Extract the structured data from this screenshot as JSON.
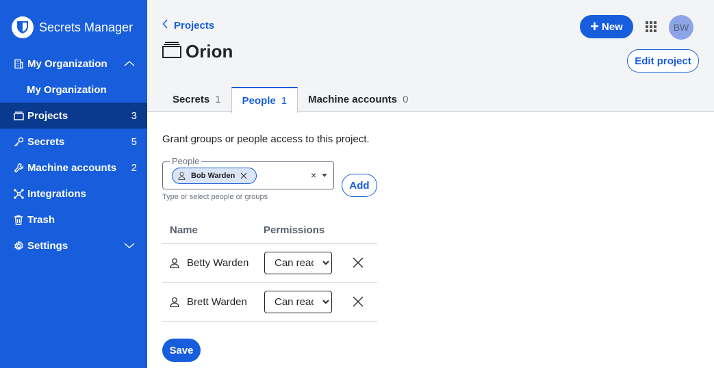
{
  "app": {
    "name": "Secrets Manager"
  },
  "colors": {
    "brand": "#175ddc",
    "sidebar_active": "#0a3a8f"
  },
  "sidebar": {
    "org_label": "My Organization",
    "org_sub": "My Organization",
    "items": [
      {
        "label": "Projects",
        "count": "3",
        "icon": "folder-icon"
      },
      {
        "label": "Secrets",
        "count": "5",
        "icon": "key-icon"
      },
      {
        "label": "Machine accounts",
        "count": "2",
        "icon": "wrench-icon"
      },
      {
        "label": "Integrations",
        "count": "",
        "icon": "integrations-icon"
      },
      {
        "label": "Trash",
        "count": "",
        "icon": "trash-icon"
      },
      {
        "label": "Settings",
        "count": "",
        "icon": "gear-icon"
      }
    ]
  },
  "header": {
    "breadcrumb": "Projects",
    "title": "Orion",
    "new_label": "New",
    "avatar_initials": "BW",
    "edit_label": "Edit project"
  },
  "tabs": [
    {
      "label": "Secrets",
      "count": "1"
    },
    {
      "label": "People",
      "count": "1"
    },
    {
      "label": "Machine accounts",
      "count": "0"
    }
  ],
  "access": {
    "intro": "Grant groups or people access to this project.",
    "field_label": "People",
    "chip": "Bob Warden",
    "clear": "×",
    "hint": "Type or select people or groups",
    "add_label": "Add"
  },
  "table": {
    "headers": [
      "Name",
      "Permissions"
    ],
    "rows": [
      {
        "name": "Betty Warden",
        "permission": "Can read"
      },
      {
        "name": "Brett Warden",
        "permission": "Can read"
      }
    ]
  },
  "save_label": "Save"
}
